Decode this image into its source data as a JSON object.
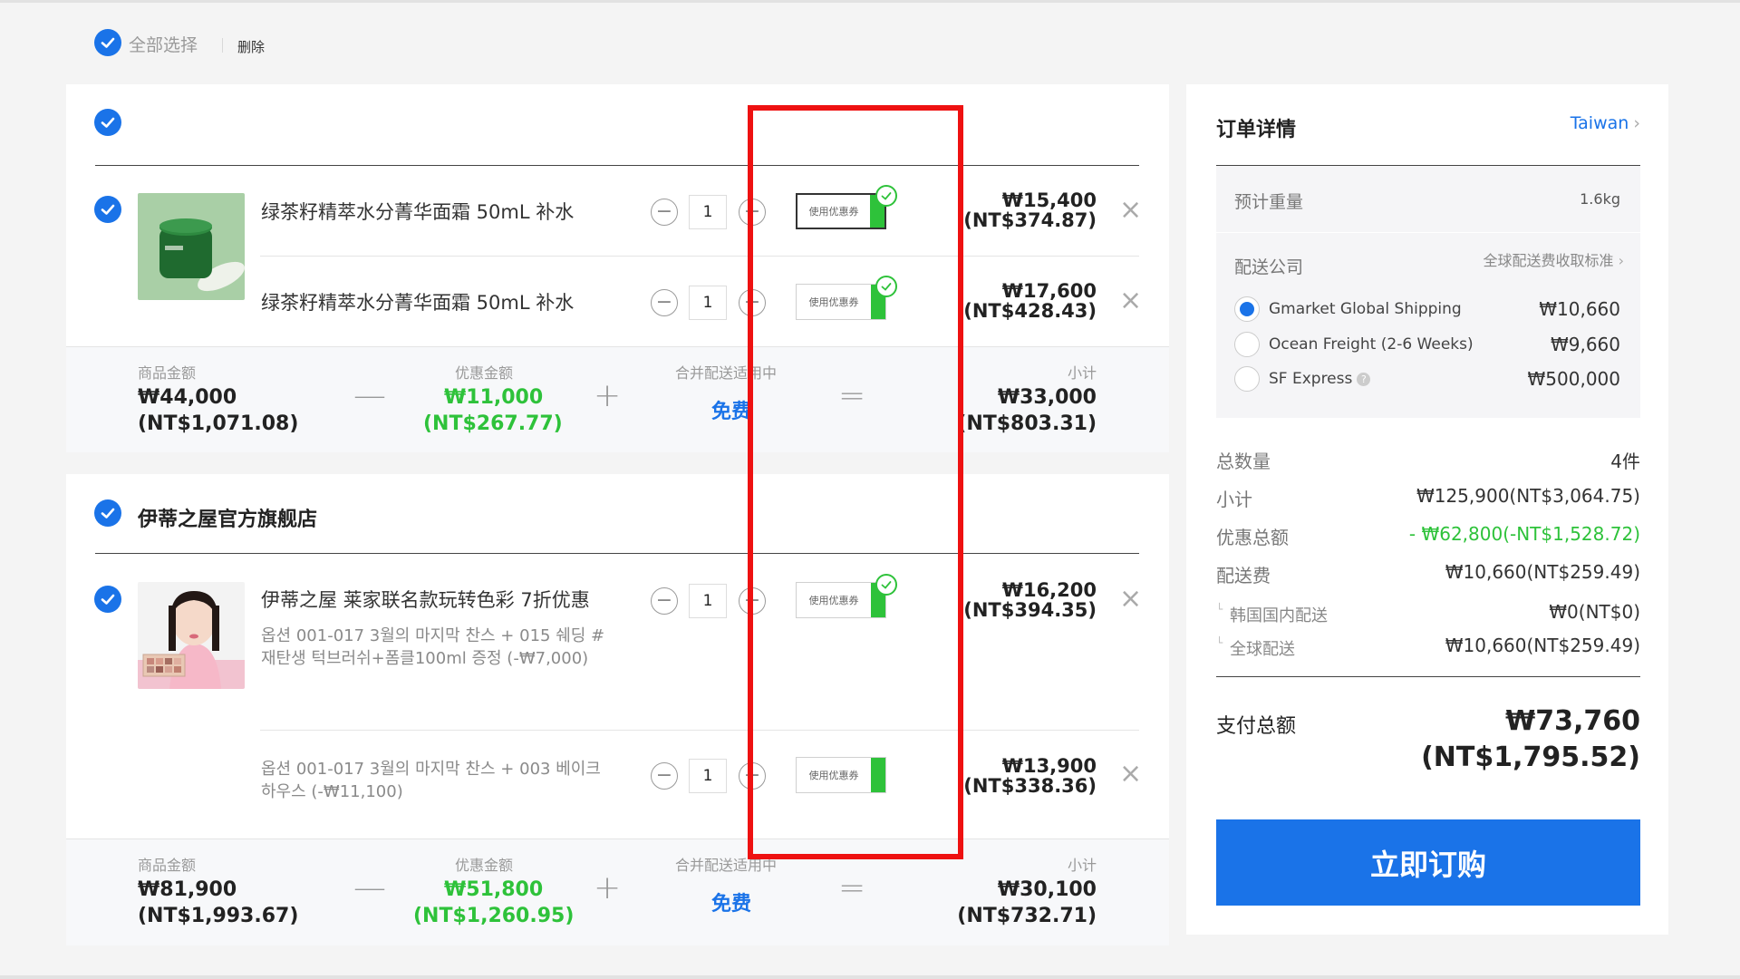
{
  "top": {
    "select_all": "全部选择",
    "delete": "删除"
  },
  "group1": {
    "items": [
      {
        "name": "绿茶籽精萃水分菁华面霜 50mL 补水",
        "qty": "1",
        "coupon": "使用优惠券",
        "price_krw": "₩15,400",
        "price_nt": "(NT$374.87)"
      },
      {
        "name": "绿茶籽精萃水分菁华面霜 50mL 补水",
        "qty": "1",
        "coupon": "使用优惠券",
        "price_krw": "₩17,600",
        "price_nt": "(NT$428.43)"
      }
    ],
    "summary": {
      "goods_label": "商品金额",
      "goods_krw": "₩44,000",
      "goods_nt": "(NT$1,071.08)",
      "discount_label": "优惠金额",
      "discount_krw": "₩11,000",
      "discount_nt": "(NT$267.77)",
      "shipping_label": "合并配送适用中",
      "shipping_val": "免费",
      "subtotal_label": "小计",
      "subtotal_krw": "₩33,000",
      "subtotal_nt": "(NT$803.31)"
    }
  },
  "group2": {
    "store": "伊蒂之屋官方旗舰店",
    "items": [
      {
        "name": "伊蒂之屋 莱家联名款玩转色彩 7折优惠",
        "option": "옵션 001-017 3월의 마지막 찬스 + 015 쉐딩 #재탄생 턱브러쉬+폼클100ml 증정 (-₩7,000)",
        "qty": "1",
        "coupon": "使用优惠券",
        "price_krw": "₩16,200",
        "price_nt": "(NT$394.35)"
      },
      {
        "option": "옵션 001-017 3월의 마지막 찬스 + 003 베이크 하우스 (-₩11,100)",
        "qty": "1",
        "coupon": "使用优惠券",
        "price_krw": "₩13,900",
        "price_nt": "(NT$338.36)"
      }
    ],
    "summary": {
      "goods_label": "商品金额",
      "goods_krw": "₩81,900",
      "goods_nt": "(NT$1,993.67)",
      "discount_label": "优惠金额",
      "discount_krw": "₩51,800",
      "discount_nt": "(NT$1,260.95)",
      "shipping_label": "合并配送适用中",
      "shipping_val": "免费",
      "subtotal_label": "小计",
      "subtotal_krw": "₩30,100",
      "subtotal_nt": "(NT$732.71)"
    }
  },
  "order": {
    "title": "订单详情",
    "region": "Taiwan",
    "weight_label": "预计重量",
    "weight_val": "1.6kg",
    "carrier_label": "配送公司",
    "fee_standard": "全球配送费收取标准",
    "carriers": [
      {
        "name": "Gmarket Global Shipping",
        "price": "₩10,660",
        "selected": true
      },
      {
        "name": "Ocean Freight (2-6 Weeks)",
        "price": "₩9,660",
        "selected": false
      },
      {
        "name": "SF Express",
        "price": "₩500,000",
        "selected": false
      }
    ],
    "rows": {
      "qty_label": "总数量",
      "qty_val": "4件",
      "subtotal_label": "小计",
      "subtotal_val": "₩125,900(NT$3,064.75)",
      "discount_label": "优惠总额",
      "discount_val": "- ₩62,800(-NT$1,528.72)",
      "shipping_label": "配送费",
      "shipping_val": "₩10,660(NT$259.49)",
      "domestic_label": "韩国国内配送",
      "domestic_val": "₩0(NT$0)",
      "global_label": "全球配送",
      "global_val": "₩10,660(NT$259.49)"
    },
    "total_label": "支付总额",
    "total_krw": "₩73,760",
    "total_nt": "(NT$1,795.52)",
    "order_button": "立即订购"
  },
  "colors": {
    "accent": "#1a73e8",
    "green": "#2ec23a",
    "highlight": "#ee1111"
  }
}
